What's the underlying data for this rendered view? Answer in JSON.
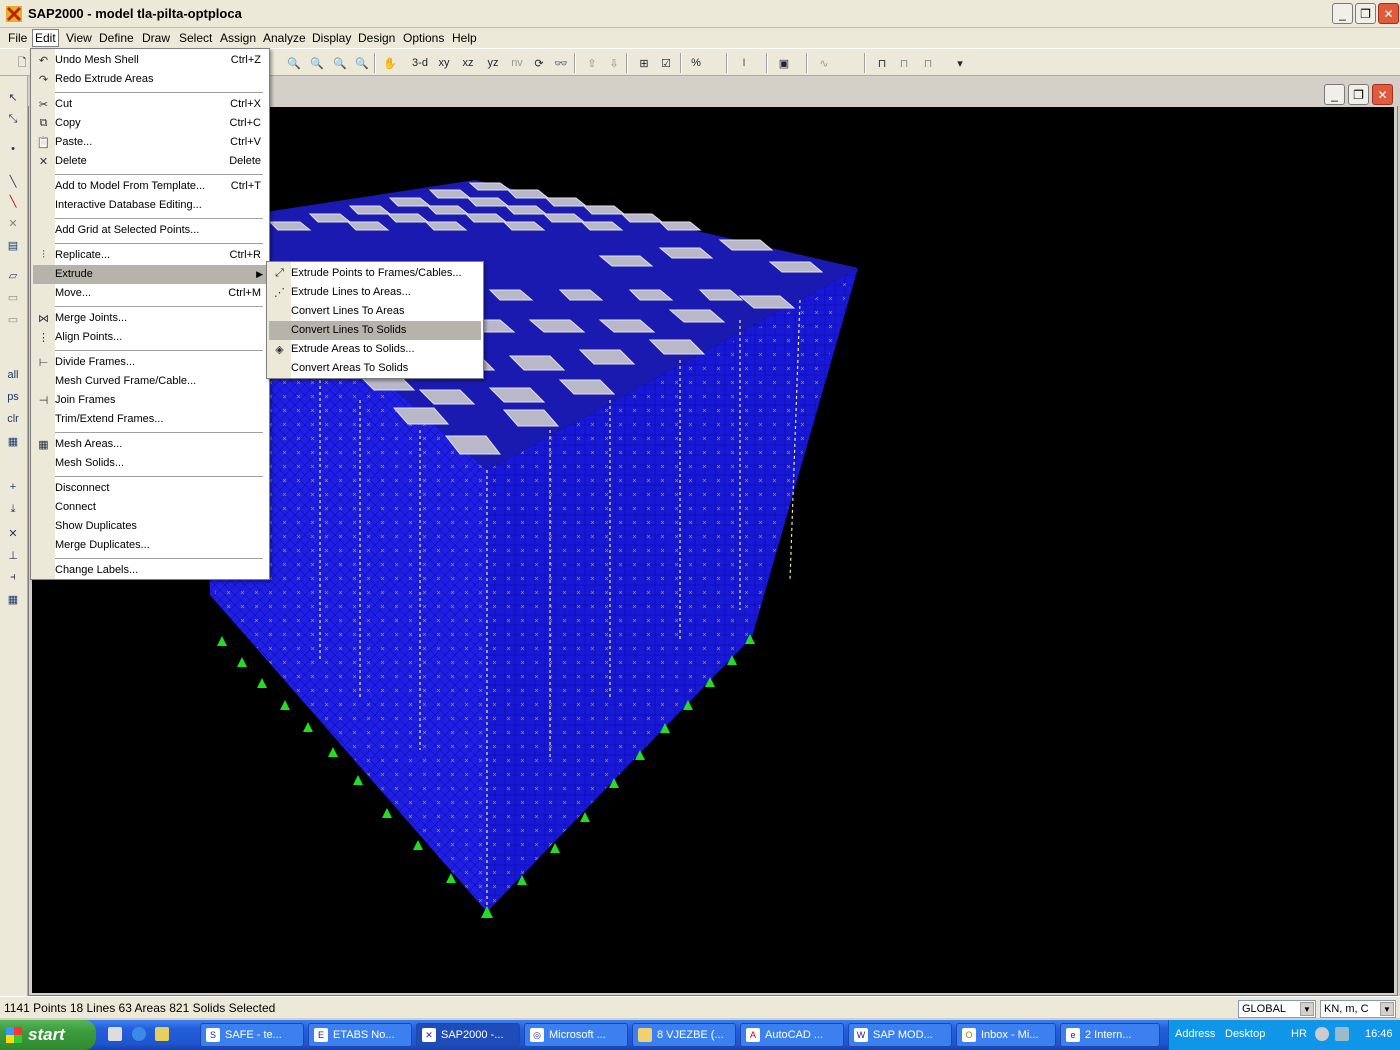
{
  "window": {
    "title": "SAP2000 - model tla-pilta-optploca",
    "minimize": "_",
    "restore": "❐",
    "close": "✕"
  },
  "menubar": [
    "File",
    "Edit",
    "View",
    "Define",
    "Draw",
    "Select",
    "Assign",
    "Analyze",
    "Display",
    "Design",
    "Options",
    "Help"
  ],
  "toolbar": {
    "view_3d": "3-d",
    "view_xy": "xy",
    "view_xz": "xz",
    "view_yz": "yz",
    "view_nv": "nv"
  },
  "edit_menu": {
    "items": [
      {
        "label": "Undo Mesh Shell",
        "shortcut": "Ctrl+Z",
        "icon": "undo-icon"
      },
      {
        "label": "Redo Extrude Areas",
        "shortcut": "",
        "icon": "redo-icon"
      },
      {
        "label": "Cut",
        "shortcut": "Ctrl+X",
        "icon": "scissors-icon"
      },
      {
        "label": "Copy",
        "shortcut": "Ctrl+C",
        "icon": "copy-icon"
      },
      {
        "label": "Paste...",
        "shortcut": "Ctrl+V",
        "icon": "paste-icon"
      },
      {
        "label": "Delete",
        "shortcut": "Delete",
        "icon": "delete-x-icon"
      },
      {
        "label": "Add to Model From Template...",
        "shortcut": "Ctrl+T",
        "icon": ""
      },
      {
        "label": "Interactive Database Editing...",
        "shortcut": "",
        "icon": ""
      },
      {
        "label": "Add Grid at Selected Points...",
        "shortcut": "",
        "icon": ""
      },
      {
        "label": "Replicate...",
        "shortcut": "Ctrl+R",
        "icon": "replicate-icon"
      },
      {
        "label": "Extrude",
        "shortcut": "",
        "icon": ""
      },
      {
        "label": "Move...",
        "shortcut": "Ctrl+M",
        "icon": ""
      },
      {
        "label": "Merge Joints...",
        "shortcut": "",
        "icon": "merge-joints-icon"
      },
      {
        "label": "Align Points...",
        "shortcut": "",
        "icon": "align-points-icon"
      },
      {
        "label": "Divide Frames...",
        "shortcut": "",
        "icon": "divide-frames-icon"
      },
      {
        "label": "Mesh Curved Frame/Cable...",
        "shortcut": "",
        "icon": ""
      },
      {
        "label": "Join Frames",
        "shortcut": "",
        "icon": "join-frames-icon"
      },
      {
        "label": "Trim/Extend Frames...",
        "shortcut": "",
        "icon": ""
      },
      {
        "label": "Mesh Areas...",
        "shortcut": "",
        "icon": "mesh-areas-icon"
      },
      {
        "label": "Mesh Solids...",
        "shortcut": "",
        "icon": ""
      },
      {
        "label": "Disconnect",
        "shortcut": "",
        "icon": ""
      },
      {
        "label": "Connect",
        "shortcut": "",
        "icon": ""
      },
      {
        "label": "Show Duplicates",
        "shortcut": "",
        "icon": ""
      },
      {
        "label": "Merge Duplicates...",
        "shortcut": "",
        "icon": ""
      },
      {
        "label": "Change Labels...",
        "shortcut": "",
        "icon": ""
      }
    ]
  },
  "extrude_submenu": {
    "items": [
      {
        "label": "Extrude Points to Frames/Cables...",
        "icon": "extrude-points-icon"
      },
      {
        "label": "Extrude Lines to Areas...",
        "icon": "extrude-lines-icon"
      },
      {
        "label": "Convert Lines To Areas",
        "icon": ""
      },
      {
        "label": "Convert Lines To Solids",
        "icon": ""
      },
      {
        "label": "Extrude Areas to Solids...",
        "icon": "extrude-areas-icon"
      },
      {
        "label": "Convert Areas To Solids",
        "icon": ""
      }
    ]
  },
  "status": {
    "selection": "1141 Points  18 Lines  63 Areas  821 Solids Selected",
    "coord_system": "GLOBAL",
    "units": "KN, m, C"
  },
  "taskbar": {
    "start": "start",
    "tasks": [
      "SAFE - te...",
      "ETABS No...",
      "SAP2000 -...",
      "Microsoft ...",
      "8 VJEZBE (...",
      "AutoCAD ...",
      "SAP  MOD...",
      "Inbox - Mi...",
      "2 Intern..."
    ],
    "address": "Address",
    "desktop": "Desktop",
    "lang": "HR",
    "clock": "16:46"
  },
  "colors": {
    "model_blue": "#1a1ae6",
    "support_green": "#22dd22",
    "pile_caps": "#b8b8c8"
  }
}
